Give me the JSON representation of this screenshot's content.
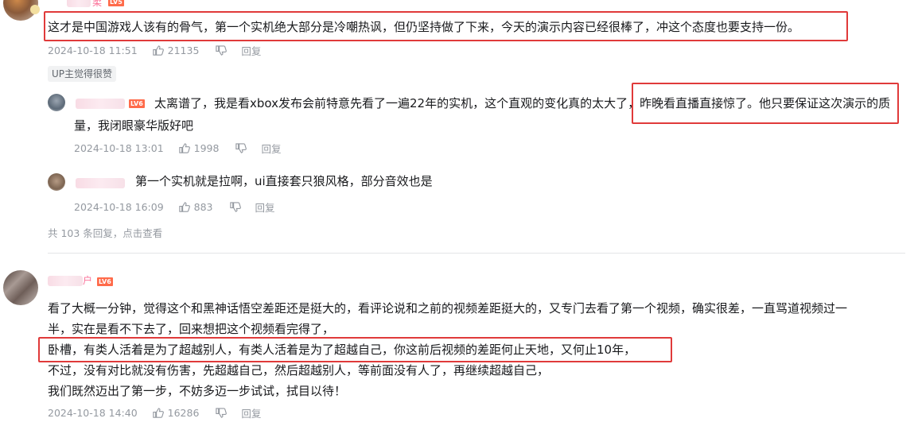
{
  "comments": [
    {
      "level": "LV5",
      "username_fragment": "柔",
      "text": "这才是中国游戏人该有的骨气，第一个实机绝大部分是冷嘲热讽，但仍坚持做了下来，今天的演示内容已经很棒了，冲这个态度也要支持一份。",
      "time": "2024-10-18 11:51",
      "likes": "21135",
      "reply_label": "回复",
      "up_tag": "UP主觉得很赞",
      "replies": [
        {
          "level": "LV6",
          "text_line1": "太离谱了，我是看xbox发布会前特意先看了一遍22年的实机，这个直观的变化真的太大了，昨晚看直播直接惊了。他只要保证这次演示的质",
          "text_line2": "量，我闭眼豪华版好吧",
          "time": "2024-10-18 13:01",
          "likes": "1998",
          "reply_label": "回复"
        },
        {
          "text": "第一个实机就是拉啊，ui直接套只狼风格，部分音效也是",
          "time": "2024-10-18 16:09",
          "likes": "883",
          "reply_label": "回复"
        }
      ],
      "more_replies": "共 103 条回复，点击查看"
    },
    {
      "level": "LV6",
      "username_fragment": "户",
      "lines": [
        "看了大概一分钟，觉得这个和黑神话悟空差距还是挺大的，看评论说和之前的视频差距挺大的，又专门去看了第一个视频，确实很差，一直骂道视频过一",
        "半，实在是看不下去了，回来想把这个视频看完得了，",
        "卧槽，有类人活着是为了超越别人，有类人活着是为了超越自己，你这前后视频的差距何止天地，又何止10年，",
        "不过，没有对比就没有伤害，先超越自己，然后超越别人，等前面没有人了，再继续超越自己，",
        "我们既然迈出了第一步，不妨多迈一步试试，拭目以待！"
      ],
      "time": "2024-10-18 14:40",
      "likes": "16286",
      "reply_label": "回复"
    }
  ],
  "colors": {
    "highlight_box": "#e03a3a",
    "meta_text": "#9499a0",
    "level_badge": "#ff6b4a"
  }
}
